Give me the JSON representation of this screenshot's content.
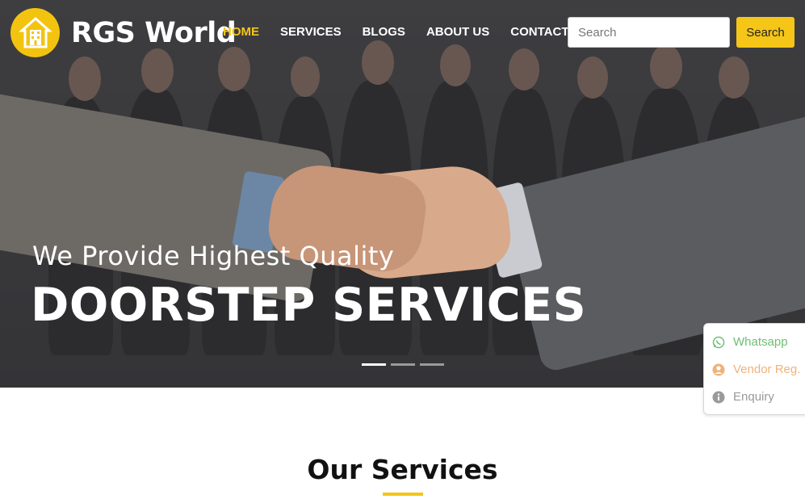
{
  "brand": {
    "name": "RGS World",
    "logo_icon": "house-building-icon",
    "color": "#f2c40f"
  },
  "nav": {
    "items": [
      {
        "label": "HOME",
        "active": true
      },
      {
        "label": "SERVICES",
        "active": false
      },
      {
        "label": "BLOGS",
        "active": false
      },
      {
        "label": "ABOUT US",
        "active": false
      },
      {
        "label": "CONTACT",
        "active": false
      }
    ],
    "active_color": "#f5c518"
  },
  "search": {
    "placeholder": "Search",
    "value": "",
    "button_label": "Search"
  },
  "hero": {
    "subtitle": "We Provide Highest Quality",
    "title": "DOORSTEP SERVICES",
    "slides": 3,
    "active_slide": 1
  },
  "float_panel": {
    "items": [
      {
        "label": "Whatsapp",
        "icon": "whatsapp-icon",
        "color": "#6fbf73"
      },
      {
        "label": "Vendor Reg.",
        "icon": "user-circle-icon",
        "color": "#f0b27a"
      },
      {
        "label": "Enquiry",
        "icon": "info-circle-icon",
        "color": "#9a9a9a"
      }
    ]
  },
  "services": {
    "title": "Our Services",
    "accent": "#f5c518"
  }
}
